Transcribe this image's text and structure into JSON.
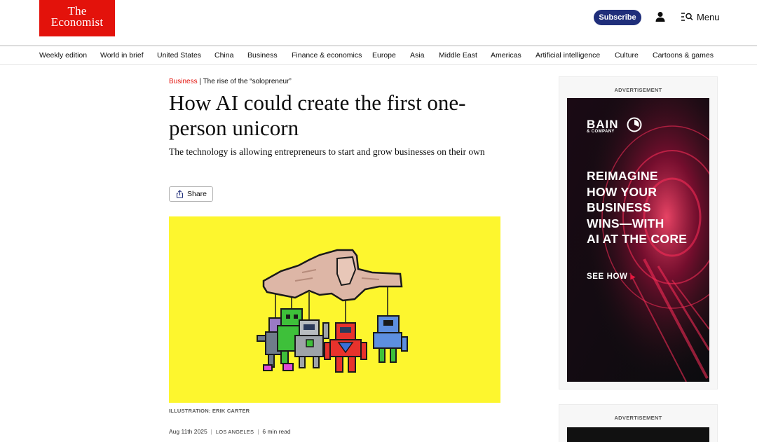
{
  "header": {
    "logo_line1": "The",
    "logo_line2": "Economist",
    "subscribe_label": "Subscribe",
    "menu_label": "Menu",
    "brand_color": "#e3120b",
    "subscribe_color": "#1f2e7a"
  },
  "nav": {
    "items": [
      "Weekly edition",
      "World in brief",
      "United States",
      "China",
      "Business",
      "Finance & economics",
      "Europe",
      "Asia",
      "Middle East",
      "Americas",
      "Artificial intelligence",
      "Culture",
      "Cartoons & games"
    ]
  },
  "article": {
    "section": "Business",
    "kicker_separator": "|",
    "rubric": "The rise of the “solopreneur”",
    "headline": "How AI could create the first one-person unicorn",
    "standfirst": "The technology is allowing entrepreneurs to start and grow businesses on their own",
    "share_label": "Share",
    "image_caption": "ILLUSTRATION: ERIK CARTER",
    "date": "Aug 11th 2025",
    "location": "LOS ANGELES",
    "read_time": "6 min read",
    "meta_separator": "|",
    "hero_background": "#fdf62e"
  },
  "ads": {
    "label_1": "ADVERTISEMENT",
    "label_2": "ADVERTISEMENT",
    "brand": "BAIN",
    "brand_sub": "& COMPANY",
    "copy_lines": [
      "REIMAGINE",
      "HOW YOUR",
      "BUSINESS",
      "WINS—WITH",
      "AI AT THE CORE"
    ],
    "cta": "SEE HOW",
    "accent_color": "#e8173f"
  },
  "icons": {
    "user": "user-icon",
    "menu": "menu-search-icon",
    "share": "share-icon",
    "cta_arrow": "arrow-right-icon"
  }
}
